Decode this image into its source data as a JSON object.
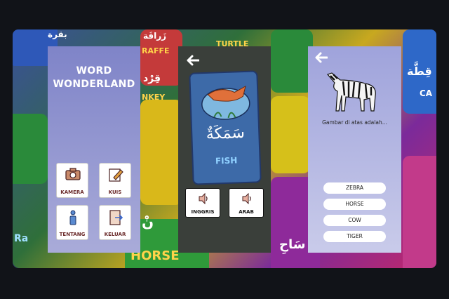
{
  "background": {
    "words": [
      "زَرافَة",
      "RAFFE",
      "TURTLE",
      "قِرْد",
      "NKEY",
      "Ra",
      "HORSE",
      "نْ",
      "سَاحِ",
      "CA",
      "قِطَّة",
      "بقرة"
    ]
  },
  "menu_screen": {
    "title_line1": "WORD",
    "title_line2": "WONDERLAND",
    "tiles": [
      {
        "label": "KAMERA",
        "icon": "camera-icon"
      },
      {
        "label": "KUIS",
        "icon": "pencil-note-icon"
      },
      {
        "label": "TENTANG",
        "icon": "info-icon"
      },
      {
        "label": "KELUAR",
        "icon": "exit-door-icon"
      }
    ]
  },
  "ar_screen": {
    "back_icon": "back-arrow-icon",
    "card_arabic": "سَمَكَةٌ",
    "card_label": "FISH",
    "sound_buttons": [
      {
        "label": "INGGRIS",
        "icon": "speaker-icon"
      },
      {
        "label": "ARAB",
        "icon": "speaker-icon"
      }
    ]
  },
  "quiz_screen": {
    "back_icon": "back-arrow-icon",
    "image_icon": "zebra-icon",
    "question": "Gambar di atas adalah...",
    "options": [
      "ZEBRA",
      "HORSE",
      "COW",
      "TIGER"
    ]
  },
  "colors": {
    "menu_bg": "#8d91cf",
    "quiz_bg": "#b3b5e2",
    "card_blue": "#3d6aa8",
    "tile_label": "#6a2a2a"
  }
}
